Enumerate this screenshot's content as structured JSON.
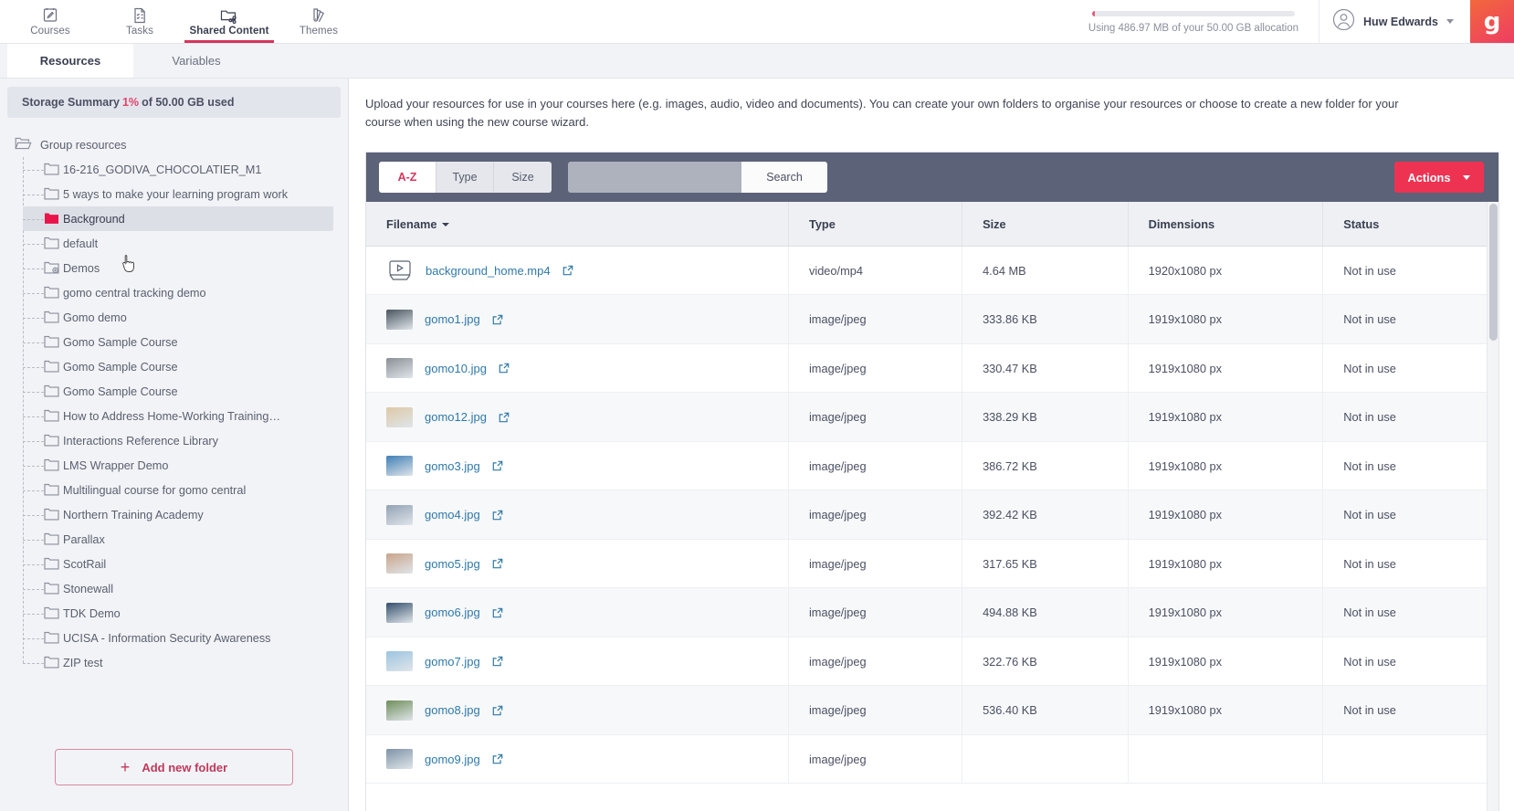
{
  "topnav": {
    "tabs": [
      {
        "label": "Courses",
        "icon": "courses-icon",
        "active": false
      },
      {
        "label": "Tasks",
        "icon": "tasks-icon",
        "active": false
      },
      {
        "label": "Shared Content",
        "icon": "shared-content-icon",
        "active": true
      },
      {
        "label": "Themes",
        "icon": "themes-icon",
        "active": false
      }
    ],
    "storage_bar_label": "Using 486.97 MB of your 50.00 GB allocation",
    "storage_bar_percent": "1",
    "user_name": "Huw Edwards",
    "brand_letter": "g"
  },
  "subtabs": [
    {
      "label": "Resources",
      "active": true
    },
    {
      "label": "Variables",
      "active": false
    }
  ],
  "sidebar": {
    "storage_summary": {
      "prefix": "Storage Summary",
      "percent": "1%",
      "suffix": "of 50.00 GB used"
    },
    "root_label": "Group resources",
    "folders": [
      {
        "label": "16-216_GODIVA_CHOCOLATIER_M1",
        "selected": false,
        "kind": "plain"
      },
      {
        "label": "5 ways to make your learning program work",
        "selected": false,
        "kind": "plain"
      },
      {
        "label": "Background",
        "selected": true,
        "kind": "filled"
      },
      {
        "label": "default",
        "selected": false,
        "kind": "plain"
      },
      {
        "label": "Demos",
        "selected": false,
        "kind": "add"
      },
      {
        "label": "gomo central tracking demo",
        "selected": false,
        "kind": "plain"
      },
      {
        "label": "Gomo demo",
        "selected": false,
        "kind": "plain"
      },
      {
        "label": "Gomo Sample Course",
        "selected": false,
        "kind": "plain"
      },
      {
        "label": "Gomo Sample Course",
        "selected": false,
        "kind": "plain"
      },
      {
        "label": "Gomo Sample Course",
        "selected": false,
        "kind": "plain"
      },
      {
        "label": "How to Address Home-Working Training…",
        "selected": false,
        "kind": "plain"
      },
      {
        "label": "Interactions Reference Library",
        "selected": false,
        "kind": "plain"
      },
      {
        "label": "LMS Wrapper Demo",
        "selected": false,
        "kind": "plain"
      },
      {
        "label": "Multilingual course for gomo central",
        "selected": false,
        "kind": "plain"
      },
      {
        "label": "Northern Training Academy",
        "selected": false,
        "kind": "plain"
      },
      {
        "label": "Parallax",
        "selected": false,
        "kind": "plain"
      },
      {
        "label": "ScotRail",
        "selected": false,
        "kind": "plain"
      },
      {
        "label": "Stonewall",
        "selected": false,
        "kind": "plain"
      },
      {
        "label": "TDK Demo",
        "selected": false,
        "kind": "plain"
      },
      {
        "label": "UCISA - Information Security Awareness",
        "selected": false,
        "kind": "plain"
      },
      {
        "label": "ZIP test",
        "selected": false,
        "kind": "plain"
      }
    ],
    "add_folder_label": "Add new folder"
  },
  "main": {
    "intro": "Upload your resources for use in your courses here (e.g. images, audio, video and documents). You can create your own folders to organise your resources or choose to create a new folder for your course when using the new course wizard.",
    "toolbar": {
      "sort_segments": [
        {
          "label": "A-Z",
          "active": true
        },
        {
          "label": "Type",
          "active": false
        },
        {
          "label": "Size",
          "active": false
        }
      ],
      "search_value": "",
      "search_placeholder": "",
      "search_button_label": "Search",
      "actions_label": "Actions"
    },
    "table": {
      "columns": [
        "Filename",
        "Type",
        "Size",
        "Dimensions",
        "Status"
      ],
      "sort_column": "Filename",
      "rows": [
        {
          "filename": "background_home.mp4",
          "type": "video/mp4",
          "size": "4.64 MB",
          "dimensions": "1920x1080 px",
          "status": "Not in use",
          "thumb": "video"
        },
        {
          "filename": "gomo1.jpg",
          "type": "image/jpeg",
          "size": "333.86 KB",
          "dimensions": "1919x1080 px",
          "status": "Not in use",
          "thumb": "#4a5560"
        },
        {
          "filename": "gomo10.jpg",
          "type": "image/jpeg",
          "size": "330.47 KB",
          "dimensions": "1919x1080 px",
          "status": "Not in use",
          "thumb": "#8a9097"
        },
        {
          "filename": "gomo12.jpg",
          "type": "image/jpeg",
          "size": "338.29 KB",
          "dimensions": "1919x1080 px",
          "status": "Not in use",
          "thumb": "#ddc9a6"
        },
        {
          "filename": "gomo3.jpg",
          "type": "image/jpeg",
          "size": "386.72 KB",
          "dimensions": "1919x1080 px",
          "status": "Not in use",
          "thumb": "#3f7fb5"
        },
        {
          "filename": "gomo4.jpg",
          "type": "image/jpeg",
          "size": "392.42 KB",
          "dimensions": "1919x1080 px",
          "status": "Not in use",
          "thumb": "#93a2b4"
        },
        {
          "filename": "gomo5.jpg",
          "type": "image/jpeg",
          "size": "317.65 KB",
          "dimensions": "1919x1080 px",
          "status": "Not in use",
          "thumb": "#c9a58a"
        },
        {
          "filename": "gomo6.jpg",
          "type": "image/jpeg",
          "size": "494.88 KB",
          "dimensions": "1919x1080 px",
          "status": "Not in use",
          "thumb": "#35506b"
        },
        {
          "filename": "gomo7.jpg",
          "type": "image/jpeg",
          "size": "322.76 KB",
          "dimensions": "1919x1080 px",
          "status": "Not in use",
          "thumb": "#9dc4e0"
        },
        {
          "filename": "gomo8.jpg",
          "type": "image/jpeg",
          "size": "536.40 KB",
          "dimensions": "1919x1080 px",
          "status": "Not in use",
          "thumb": "#6f8f5a"
        },
        {
          "filename": "gomo9.jpg",
          "type": "image/jpeg",
          "size": "",
          "dimensions": "",
          "status": "",
          "thumb": "#7e93a6"
        }
      ]
    }
  },
  "colors": {
    "brand_pink": "#d6355c",
    "action_red": "#ee3352",
    "toolbar_slate": "#5c6278",
    "link_blue": "#2f79a8"
  }
}
